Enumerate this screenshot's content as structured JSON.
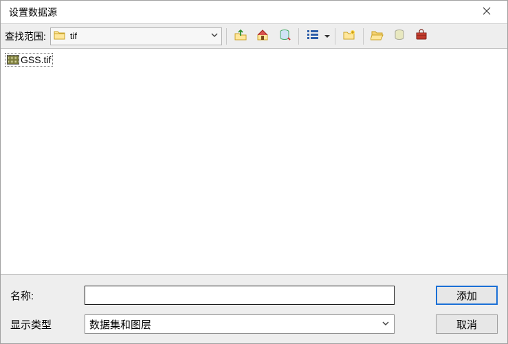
{
  "window": {
    "title": "设置数据源"
  },
  "toolbar": {
    "look_in_label": "查找范围:",
    "current_folder": "tif",
    "icons": {
      "up": "up-one-level-icon",
      "home": "home-icon",
      "db": "connect-database-icon",
      "list": "list-view-icon",
      "newfolder": "new-folder-icon",
      "open": "open-folder-icon",
      "newdb": "new-geodatabase-icon",
      "toolbox": "toolbox-icon"
    }
  },
  "files": {
    "items": [
      {
        "name": "GSS.tif",
        "icon": "raster-file-icon"
      }
    ]
  },
  "bottom": {
    "name_label": "名称:",
    "name_value": "",
    "type_label": "显示类型",
    "type_value": "数据集和图层",
    "add_label": "添加",
    "cancel_label": "取消"
  }
}
